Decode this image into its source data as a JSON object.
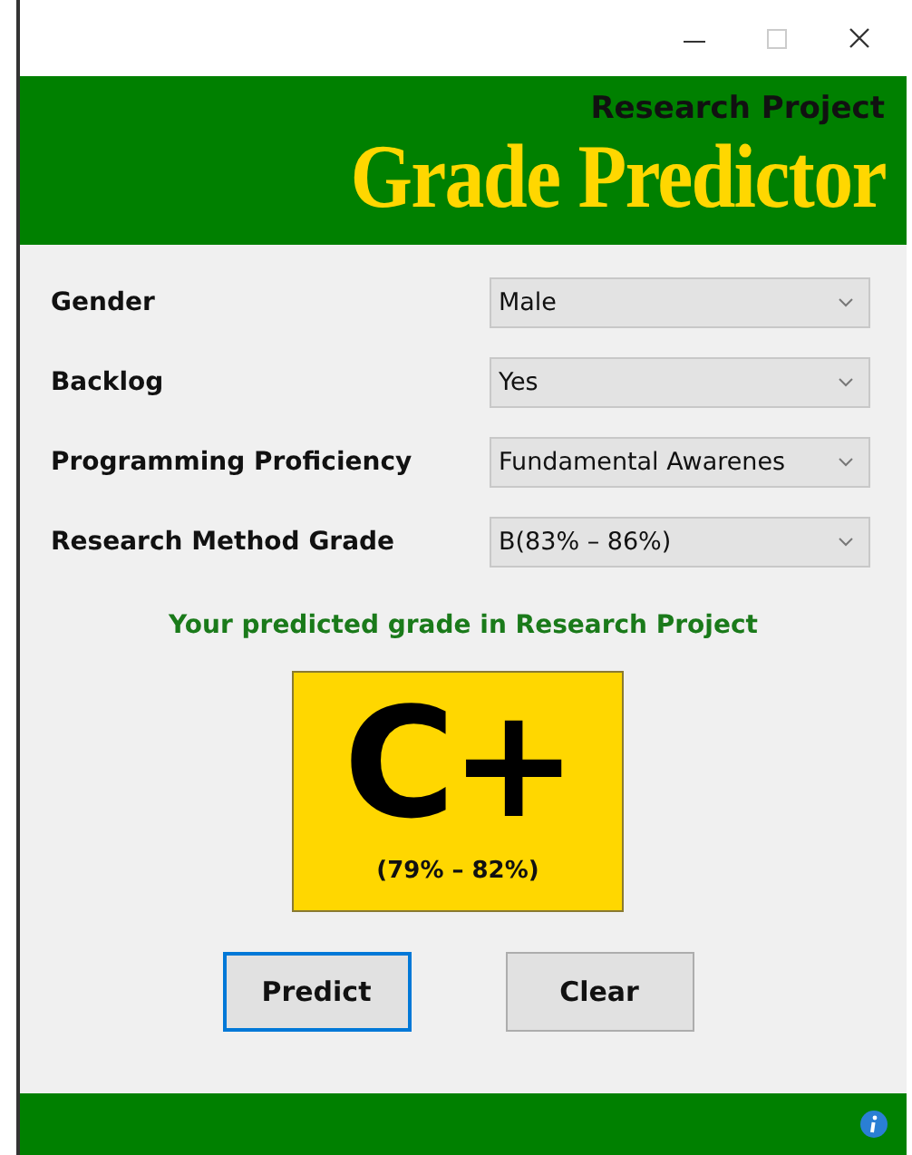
{
  "header": {
    "subtitle": "Research Project",
    "title": "Grade Predictor"
  },
  "fields": [
    {
      "label": "Gender",
      "value": "Male"
    },
    {
      "label": "Backlog",
      "value": "Yes"
    },
    {
      "label": "Programming Proficiency",
      "value": "Fundamental Awarenes"
    },
    {
      "label": "Research Method Grade",
      "value": "B(83% – 86%)"
    }
  ],
  "result": {
    "caption": "Your predicted grade in Research Project",
    "grade": "C+",
    "range": "(79% – 82%)"
  },
  "buttons": [
    {
      "label": "Predict",
      "focused": true
    },
    {
      "label": "Clear",
      "focused": false
    }
  ]
}
